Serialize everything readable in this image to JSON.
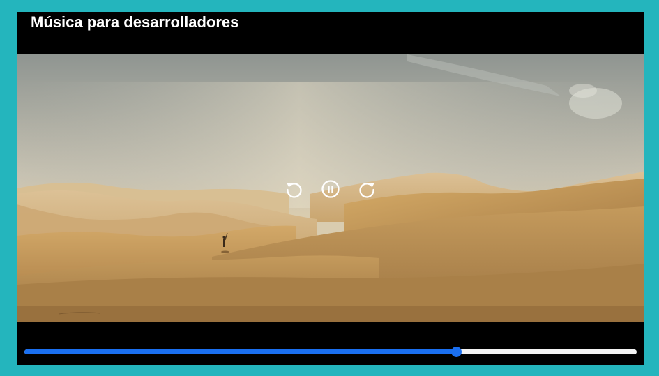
{
  "player": {
    "title": "Música para desarrolladores",
    "state": "playing",
    "progress": 0.7055,
    "colors": {
      "page_background": "#24b5bd",
      "player_background": "#000000",
      "progress_filled": "#1a6ff0",
      "progress_track": "#f2f2f2",
      "control_icons": "#ffffff"
    },
    "controls": [
      {
        "icon": "rewind-icon"
      },
      {
        "icon": "pause-icon"
      },
      {
        "icon": "forward-icon"
      }
    ]
  }
}
